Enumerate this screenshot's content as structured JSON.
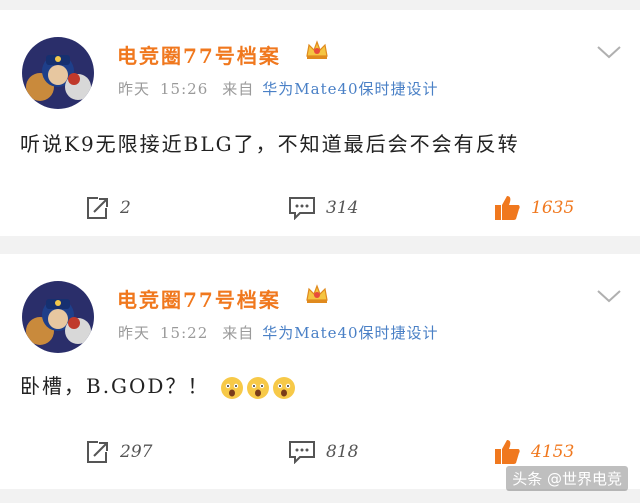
{
  "posts": [
    {
      "username": "电竞圈77号档案",
      "time_label": "昨天",
      "time": "15:26",
      "from_label": "来自",
      "source": "华为Mate40保时捷设计",
      "content": "听说K9无限接近BLG了，不知道最后会不会有反转",
      "repost_count": "2",
      "comment_count": "314",
      "like_count": "1635",
      "has_emoji": false
    },
    {
      "username": "电竞圈77号档案",
      "time_label": "昨天",
      "time": "15:22",
      "from_label": "来自",
      "source": "华为Mate40保时捷设计",
      "content": "卧槽，B.GOD？！",
      "repost_count": "297",
      "comment_count": "818",
      "like_count": "4153",
      "has_emoji": true
    }
  ],
  "watermark": "头条 @世界电竞",
  "colors": {
    "username": "#f0781e",
    "source_link": "#4a80c6",
    "like_active": "#f0781e",
    "meta_gray": "#9a9a9a"
  },
  "icons": [
    "avatar-paw-patrol",
    "crown-icon",
    "chevron-down-icon",
    "repost-icon",
    "comment-icon",
    "like-icon",
    "emoji-icon"
  ]
}
